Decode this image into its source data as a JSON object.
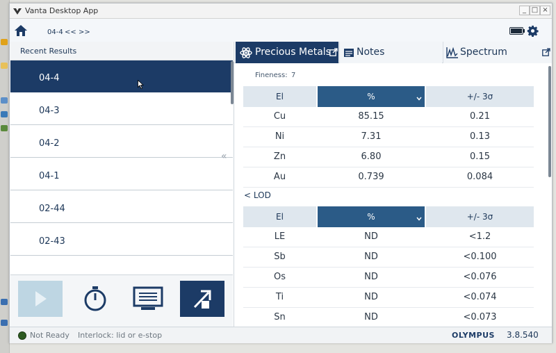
{
  "window": {
    "title": "Vanta Desktop App",
    "min_label": "_",
    "max_label": "□",
    "close_label": "×"
  },
  "nav": {
    "sample_id": "04-4",
    "prev_label": "<<",
    "next_label": ">>"
  },
  "recent": {
    "header": "Recent Results",
    "items": [
      "04-4",
      "04-3",
      "04-2",
      "04-1",
      "02-44",
      "02-43"
    ],
    "selected_index": 0
  },
  "tabs": [
    {
      "label": "Precious Metals",
      "icon": "atom-icon",
      "active": true
    },
    {
      "label": "Notes",
      "icon": "notes-icon",
      "active": false
    },
    {
      "label": "Spectrum",
      "icon": "spectrum-icon",
      "active": false
    }
  ],
  "results": {
    "fineness_label": "Fineness:",
    "fineness_value": "7",
    "columns": [
      "El",
      "%",
      "+/- 3σ"
    ],
    "rows": [
      {
        "el": "Cu",
        "pct": "85.15",
        "err": "0.21"
      },
      {
        "el": "Ni",
        "pct": "7.31",
        "err": "0.13"
      },
      {
        "el": "Zn",
        "pct": "6.80",
        "err": "0.15"
      },
      {
        "el": "Au",
        "pct": "0.739",
        "err": "0.084"
      }
    ],
    "lod_label": "< LOD",
    "lod_columns": [
      "El",
      "%",
      "+/- 3σ"
    ],
    "lod_rows": [
      {
        "el": "LE",
        "pct": "ND",
        "err": "<1.2"
      },
      {
        "el": "Sb",
        "pct": "ND",
        "err": "<0.100"
      },
      {
        "el": "Os",
        "pct": "ND",
        "err": "<0.076"
      },
      {
        "el": "Ti",
        "pct": "ND",
        "err": "<0.074"
      },
      {
        "el": "Sn",
        "pct": "ND",
        "err": "<0.073"
      }
    ]
  },
  "status": {
    "state": "Not Ready",
    "interlock": "Interlock: lid or e-stop",
    "brand": "OLYMPUS",
    "version": "3.8.540",
    "dot_color": "#2e5b22"
  },
  "colors": {
    "accent": "#1c3b66",
    "header_active": "#2b5b87",
    "run_disabled": "#bed6e3"
  }
}
